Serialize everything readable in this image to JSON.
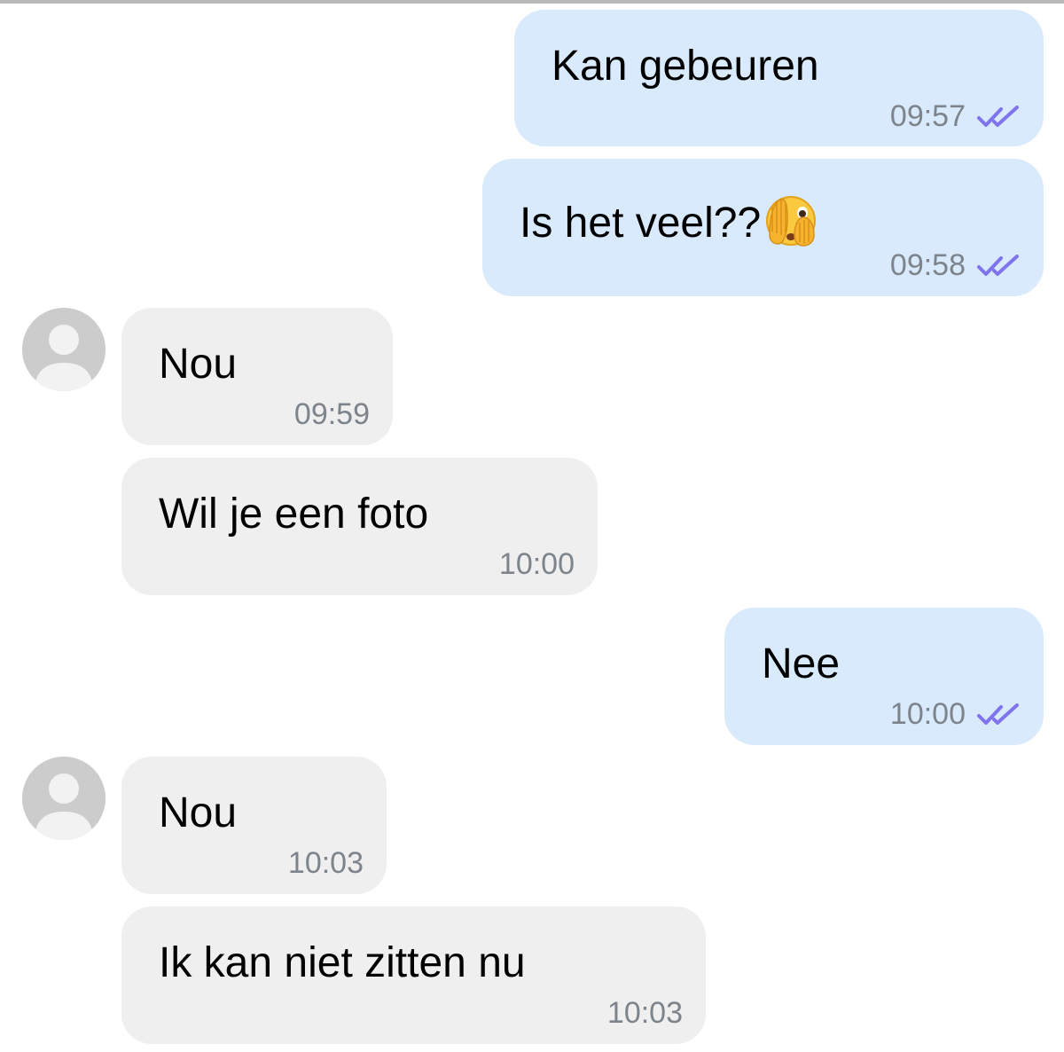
{
  "chat": {
    "messages": [
      {
        "direction": "outgoing",
        "text": "Kan gebeuren",
        "time": "09:57",
        "status": "read"
      },
      {
        "direction": "outgoing",
        "text": "Is het veel??",
        "emoji": "face-with-open-eyes-and-hand-over-mouth",
        "time": "09:58",
        "status": "read"
      },
      {
        "direction": "incoming",
        "text": "Nou",
        "time": "09:59",
        "avatar": true
      },
      {
        "direction": "incoming",
        "text": "Wil je een foto",
        "time": "10:00"
      },
      {
        "direction": "outgoing",
        "text": "Nee",
        "time": "10:00",
        "status": "read"
      },
      {
        "direction": "incoming",
        "text": "Nou",
        "time": "10:03",
        "avatar": true
      },
      {
        "direction": "incoming",
        "text": "Ik kan niet zitten nu",
        "time": "10:03"
      }
    ]
  },
  "colors": {
    "outgoing_bubble": "#d9eafd",
    "incoming_bubble": "#efefef",
    "timestamp": "#7d848c",
    "read_check": "#7f74ee",
    "avatar": "#cccccc"
  },
  "icons": {
    "read_status": "double-check-icon",
    "avatar": "default-user-avatar-icon"
  }
}
